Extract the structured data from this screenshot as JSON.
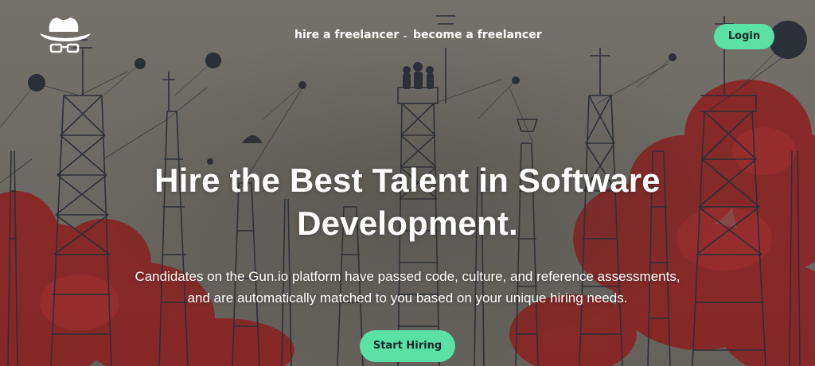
{
  "brand": {
    "logo_icon": "cowboy-hat-glasses-icon",
    "accent_color": "#5be0a6"
  },
  "nav": {
    "items": [
      {
        "label": "hire a freelancer",
        "has_dropdown": true,
        "dropdown_icon": "chevron-down-icon"
      },
      {
        "label": "become a freelancer",
        "has_dropdown": false
      }
    ],
    "login_label": "Login"
  },
  "hero": {
    "headline_line1": "Hire the Best Talent in Software",
    "headline_line2": "Development.",
    "subtext_line1": "Candidates on the Gun.io platform have passed code, culture, and reference assessments,",
    "subtext_line2": "and are automatically matched to you based on your unique hiring needs.",
    "cta_label": "Start Hiring",
    "background_colors": {
      "sky": "#6f6c66",
      "smoke": "#8a2424",
      "line_art": "#2b2f36"
    }
  }
}
